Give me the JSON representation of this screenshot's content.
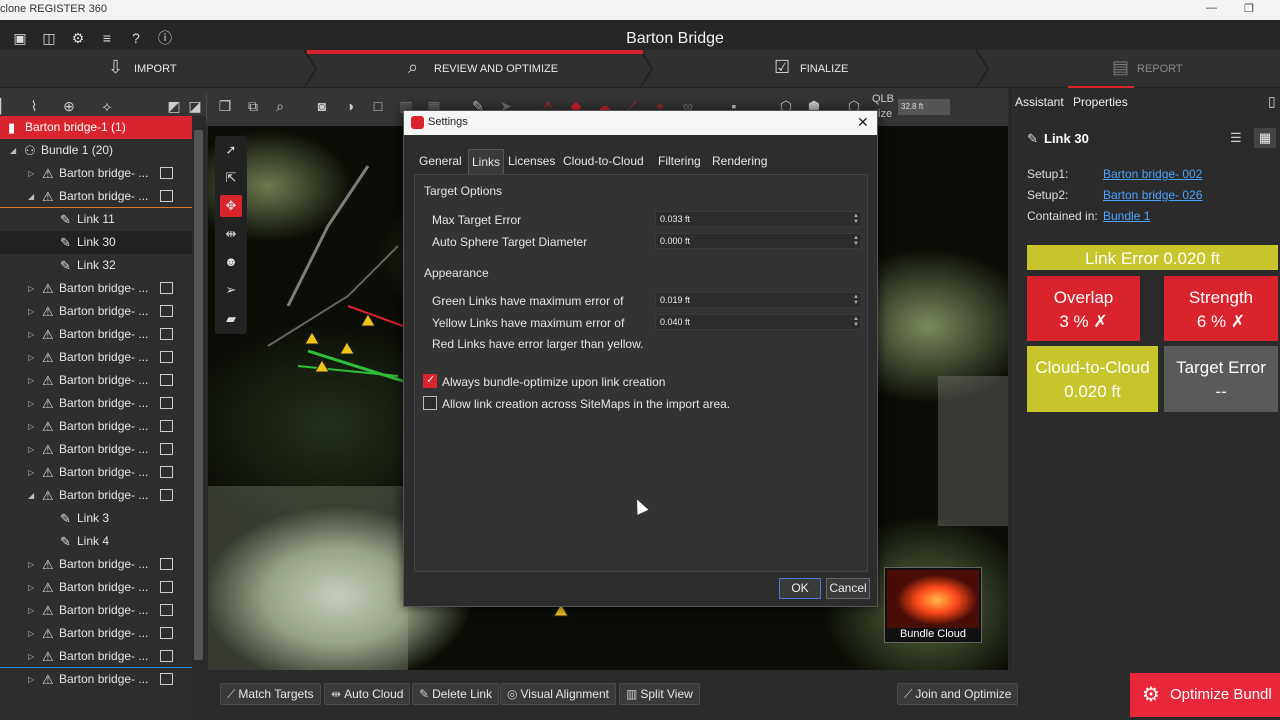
{
  "window": {
    "title": "clone REGISTER 360",
    "controls": [
      "—",
      "❐"
    ]
  },
  "header": {
    "project_title": "Barton Bridge",
    "icons": [
      "folder-icon",
      "scan-icon",
      "gear-icon",
      "database-icon",
      "help-icon",
      "info-icon"
    ]
  },
  "workflow": {
    "steps": [
      {
        "label": "IMPORT",
        "icon": "import-icon",
        "state": "normal"
      },
      {
        "label": "REVIEW AND OPTIMIZE",
        "icon": "review-icon",
        "state": "active"
      },
      {
        "label": "FINALIZE",
        "icon": "finalize-icon",
        "state": "normal"
      },
      {
        "label": "REPORT",
        "icon": "report-icon",
        "state": "disabled"
      }
    ],
    "accent_color": "#d9232d"
  },
  "toolbar": {
    "scale_label": "QLB",
    "scale_value": "32.8 ft",
    "size_label": "ize"
  },
  "tree": {
    "items": [
      {
        "label": "Barton bridge-1 (1)",
        "type": "project",
        "selected": true
      },
      {
        "label": "Bundle 1 (20)",
        "type": "bundle",
        "expanded": true
      },
      {
        "label": "Barton bridge- ...",
        "type": "setup"
      },
      {
        "label": "Barton bridge- ...",
        "type": "setup",
        "expanded": true
      },
      {
        "label": "Link 11",
        "type": "link"
      },
      {
        "label": "Link 30",
        "type": "link",
        "active": true
      },
      {
        "label": "Link 32",
        "type": "link"
      },
      {
        "label": "Barton bridge- ...",
        "type": "setup"
      },
      {
        "label": "Barton bridge- ...",
        "type": "setup"
      },
      {
        "label": "Barton bridge- ...",
        "type": "setup"
      },
      {
        "label": "Barton bridge- ...",
        "type": "setup"
      },
      {
        "label": "Barton bridge- ...",
        "type": "setup"
      },
      {
        "label": "Barton bridge- ...",
        "type": "setup"
      },
      {
        "label": "Barton bridge- ...",
        "type": "setup"
      },
      {
        "label": "Barton bridge- ...",
        "type": "setup"
      },
      {
        "label": "Barton bridge- ...",
        "type": "setup"
      },
      {
        "label": "Barton bridge- ...",
        "type": "setup",
        "expanded": true
      },
      {
        "label": "Link 3",
        "type": "link"
      },
      {
        "label": "Link 4",
        "type": "link"
      },
      {
        "label": "Barton bridge- ...",
        "type": "setup"
      },
      {
        "label": "Barton bridge- ...",
        "type": "setup"
      },
      {
        "label": "Barton bridge- ...",
        "type": "setup"
      },
      {
        "label": "Barton bridge- ...",
        "type": "setup"
      },
      {
        "label": "Barton bridge- ...",
        "type": "setup"
      },
      {
        "label": "Barton bridge- ...",
        "type": "setup"
      }
    ]
  },
  "viewport": {
    "bundle_cloud_caption": "Bundle Cloud"
  },
  "bottom_bar": {
    "match_targets": "Match Targets",
    "auto_cloud": "Auto Cloud",
    "delete_link": "Delete Link",
    "visual_alignment": "Visual Alignment",
    "split_view": "Split View",
    "join_and_optimize": "Join and Optimize",
    "optimize_bundle": "Optimize Bundl"
  },
  "right_panel": {
    "tabs": [
      "Assistant",
      "Properties"
    ],
    "link_title": "Link 30",
    "setup1_label": "Setup1:",
    "setup1_value": "Barton bridge- 002",
    "setup2_label": "Setup2:",
    "setup2_value": "Barton bridge- 026",
    "contained_label": "Contained in:",
    "contained_value": "Bundle 1",
    "link_error": "Link Error  0.020 ft",
    "overlap_label": "Overlap",
    "overlap_value": "3 %   ✗",
    "strength_label": "Strength",
    "strength_value": "6 %   ✗",
    "c2c_label": "Cloud-to-Cloud",
    "c2c_value": "0.020 ft",
    "target_error_label": "Target Error",
    "target_error_value": "--",
    "colors": {
      "yellow": "#c7c42c",
      "red": "#d9232d",
      "gray": "#5a5a5a"
    }
  },
  "dialog": {
    "title": "Settings",
    "tabs": [
      "General",
      "Links",
      "Licenses",
      "Cloud-to-Cloud",
      "Filtering",
      "Rendering"
    ],
    "active_tab": "Links",
    "target_options": {
      "heading": "Target Options",
      "max_target_error_label": "Max Target Error",
      "max_target_error_value": "0.033 ft",
      "auto_sphere_label": "Auto Sphere Target Diameter",
      "auto_sphere_value": "0.000 ft"
    },
    "appearance": {
      "heading": "Appearance",
      "green_label": "Green Links have maximum error of",
      "green_value": "0.019 ft",
      "yellow_label": "Yellow Links have maximum error of",
      "yellow_value": "0.040 ft",
      "red_label": "Red Links have error larger than yellow."
    },
    "checkboxes": [
      {
        "label": "Always bundle-optimize upon link creation",
        "checked": true
      },
      {
        "label": "Allow link creation across SiteMaps in the import area.",
        "checked": false
      }
    ],
    "ok": "OK",
    "cancel": "Cancel"
  }
}
